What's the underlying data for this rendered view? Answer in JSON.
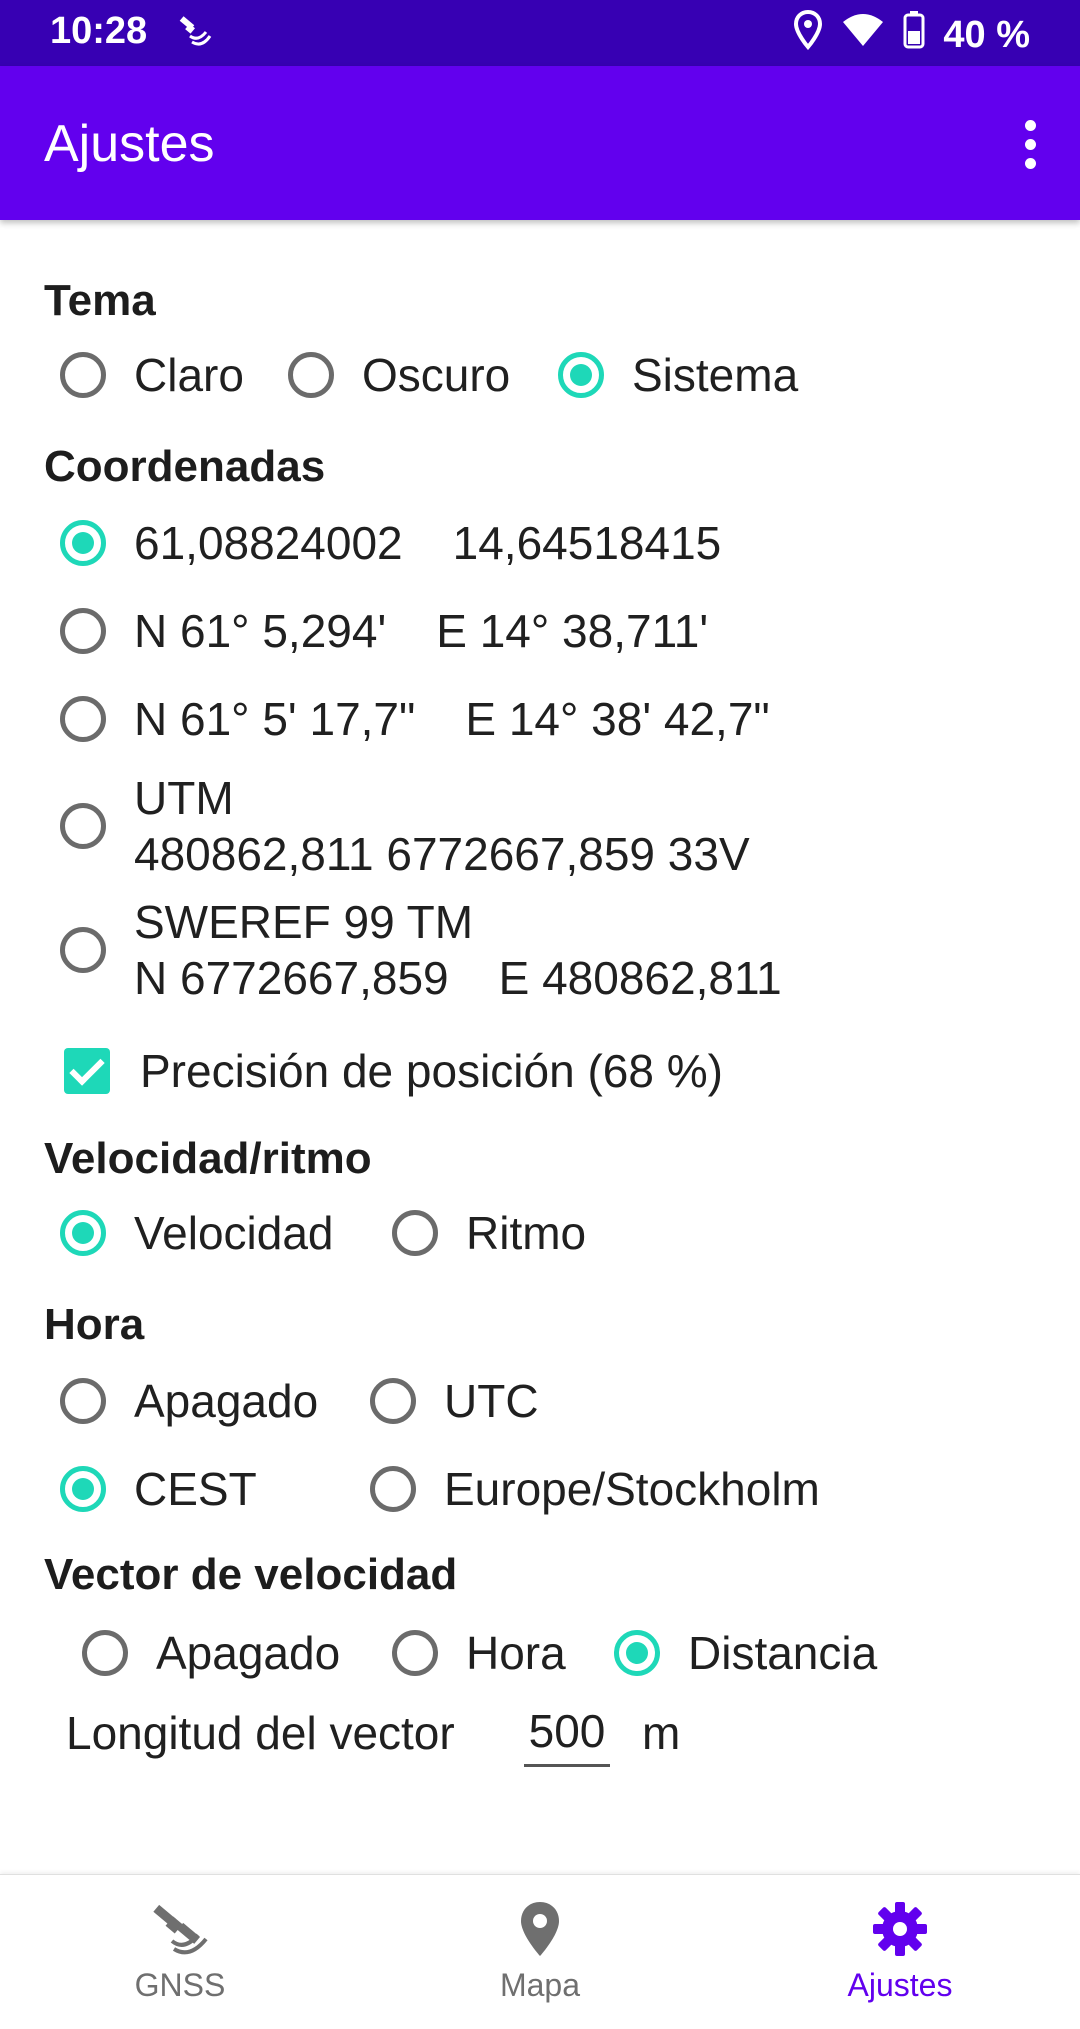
{
  "status": {
    "time": "10:28",
    "battery": "40 %"
  },
  "appbar": {
    "title": "Ajustes",
    "menu_icon": "more-vert-icon"
  },
  "tema": {
    "heading": "Tema",
    "options": [
      {
        "label": "Claro",
        "selected": false
      },
      {
        "label": "Oscuro",
        "selected": false
      },
      {
        "label": "Sistema",
        "selected": true
      }
    ]
  },
  "coordenadas": {
    "heading": "Coordenadas",
    "options": [
      {
        "a": "61,08824002",
        "b": "14,64518415",
        "selected": true
      },
      {
        "a": "N 61° 5,294'",
        "b": "E 14° 38,711'",
        "selected": false
      },
      {
        "a": "N 61° 5' 17,7\"",
        "b": "E 14° 38' 42,7\"",
        "selected": false
      },
      {
        "line1": "UTM",
        "line2": "480862,811 6772667,859 33V",
        "selected": false
      },
      {
        "line1": "SWEREF 99 TM",
        "line2a": "N 6772667,859",
        "line2b": "E 480862,811",
        "selected": false
      }
    ],
    "precision_label": "Precisión de posición (68 %)",
    "precision_checked": true
  },
  "velocidad": {
    "heading": "Velocidad/ritmo",
    "options": [
      {
        "label": "Velocidad",
        "selected": true
      },
      {
        "label": "Ritmo",
        "selected": false
      }
    ]
  },
  "hora": {
    "heading": "Hora",
    "options": [
      {
        "label": "Apagado",
        "selected": false
      },
      {
        "label": "UTC",
        "selected": false
      },
      {
        "label": "CEST",
        "selected": true
      },
      {
        "label": "Europe/Stockholm",
        "selected": false
      }
    ]
  },
  "vector": {
    "heading": "Vector de velocidad",
    "options": [
      {
        "label": "Apagado",
        "selected": false
      },
      {
        "label": "Hora",
        "selected": false
      },
      {
        "label": "Distancia",
        "selected": true
      }
    ],
    "length_label": "Longitud del vector",
    "length_value": "500",
    "length_unit": "m"
  },
  "nav": {
    "items": [
      {
        "label": "GNSS",
        "icon": "satellite-icon",
        "active": false
      },
      {
        "label": "Mapa",
        "icon": "map-pin-icon",
        "active": false
      },
      {
        "label": "Ajustes",
        "icon": "gear-icon",
        "active": true
      }
    ]
  },
  "colors": {
    "statusbar": "#3700b3",
    "appbar": "#6200ee",
    "accent": "#1ed8b8",
    "nav_active": "#6200ee"
  }
}
